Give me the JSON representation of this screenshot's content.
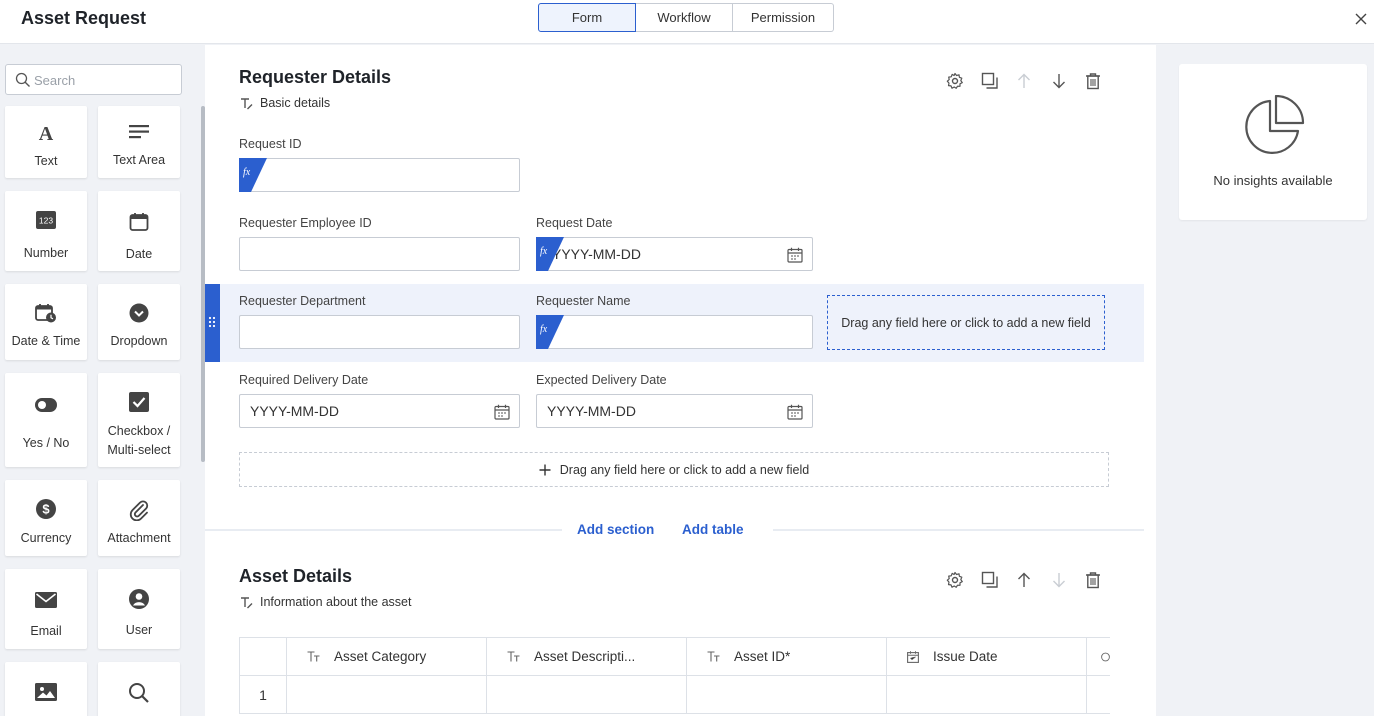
{
  "header": {
    "title": "Asset Request",
    "tabs": [
      {
        "label": "Form",
        "active": true
      },
      {
        "label": "Workflow",
        "active": false
      },
      {
        "label": "Permission",
        "active": false
      }
    ],
    "close_icon": "close-icon"
  },
  "palette": {
    "search_placeholder": "Search",
    "items": [
      {
        "label": "Text",
        "icon": "text-icon"
      },
      {
        "label": "Text Area",
        "icon": "text-area-icon"
      },
      {
        "label": "Number",
        "icon": "number-icon"
      },
      {
        "label": "Date",
        "icon": "date-icon"
      },
      {
        "label": "Date & Time",
        "icon": "date-time-icon"
      },
      {
        "label": "Dropdown",
        "icon": "dropdown-icon"
      },
      {
        "label": "Yes / No",
        "icon": "toggle-icon"
      },
      {
        "label": "Checkbox / Multi-select",
        "icon": "checkbox-icon"
      },
      {
        "label": "Currency",
        "icon": "currency-icon"
      },
      {
        "label": "Attachment",
        "icon": "attachment-icon"
      },
      {
        "label": "Email",
        "icon": "email-icon"
      },
      {
        "label": "User",
        "icon": "user-icon"
      },
      {
        "label": "",
        "icon": "image-icon"
      },
      {
        "label": "",
        "icon": "lookup-icon"
      }
    ]
  },
  "sections": [
    {
      "title": "Requester Details",
      "description": "Basic details",
      "fields": {
        "request_id": {
          "label": "Request ID",
          "value": ""
        },
        "requester_employee_id": {
          "label": "Requester Employee ID",
          "value": ""
        },
        "request_date": {
          "label": "Request Date",
          "placeholder": "YYYY-MM-DD"
        },
        "requester_department": {
          "label": "Requester Department",
          "value": ""
        },
        "requester_name": {
          "label": "Requester Name",
          "value": ""
        },
        "required_delivery_date": {
          "label": "Required Delivery Date",
          "placeholder": "YYYY-MM-DD"
        },
        "expected_delivery_date": {
          "label": "Expected Delivery Date",
          "placeholder": "YYYY-MM-DD"
        }
      },
      "row_drop_text": "Drag any field here or click to add a new field",
      "add_field_text": "Drag any field here or click to add a new field"
    },
    {
      "title": "Asset Details",
      "description": "Information about the asset",
      "table": {
        "columns": [
          {
            "label": "Asset Category",
            "icon": "text-field-icon"
          },
          {
            "label": "Asset Descripti...",
            "icon": "text-field-icon"
          },
          {
            "label": "Asset ID*",
            "icon": "text-field-icon"
          },
          {
            "label": "Issue Date",
            "icon": "date-icon"
          }
        ],
        "rows": [
          {
            "index": "1"
          }
        ]
      }
    }
  ],
  "links": {
    "add_section": "Add section",
    "add_table": "Add table"
  },
  "insights": {
    "message": "No insights available"
  },
  "colors": {
    "accent": "#2b5fcf",
    "highlight": "#eef2fb",
    "canvas": "#f0f2f6"
  }
}
